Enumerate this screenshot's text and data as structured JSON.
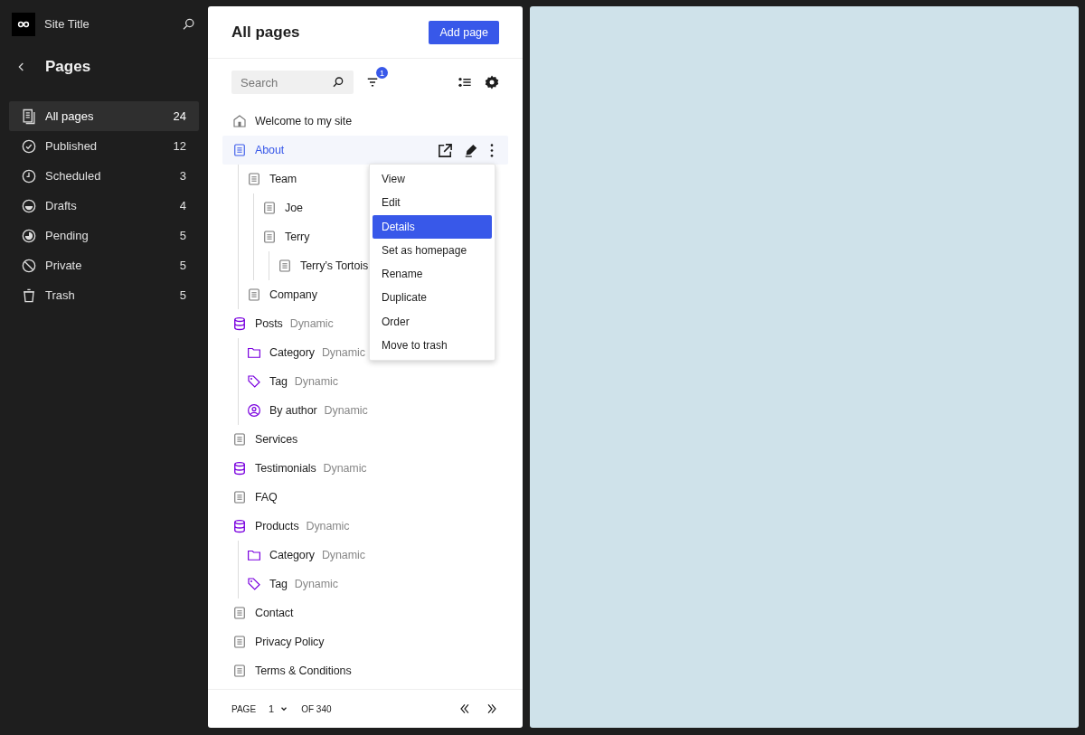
{
  "sidebar": {
    "site_title": "Site Title",
    "heading": "Pages",
    "items": [
      {
        "label": "All pages",
        "count": "24",
        "kind": "all",
        "selected": true
      },
      {
        "label": "Published",
        "count": "12",
        "kind": "published",
        "selected": false
      },
      {
        "label": "Scheduled",
        "count": "3",
        "kind": "scheduled",
        "selected": false
      },
      {
        "label": "Drafts",
        "count": "4",
        "kind": "drafts",
        "selected": false
      },
      {
        "label": "Pending",
        "count": "5",
        "kind": "pending",
        "selected": false
      },
      {
        "label": "Private",
        "count": "5",
        "kind": "private",
        "selected": false
      },
      {
        "label": "Trash",
        "count": "5",
        "kind": "trash",
        "selected": false
      }
    ]
  },
  "panel": {
    "title": "All pages",
    "add_button": "Add page",
    "search": {
      "placeholder": "Search"
    },
    "filter_badge": "1",
    "tree": [
      {
        "label": "Welcome to my site",
        "kind": "home",
        "selected": false
      },
      {
        "label": "About",
        "kind": "page",
        "selected": true,
        "children": [
          {
            "label": "Team",
            "kind": "page",
            "selected": false,
            "children": [
              {
                "label": "Joe",
                "kind": "page",
                "selected": false
              },
              {
                "label": "Terry",
                "kind": "page",
                "selected": false,
                "children": [
                  {
                    "label": "Terry’s Tortois",
                    "kind": "page",
                    "selected": false
                  }
                ]
              }
            ]
          },
          {
            "label": "Company",
            "kind": "page",
            "selected": false
          }
        ]
      },
      {
        "label": "Posts",
        "tag": "Dynamic",
        "kind": "dynamic",
        "selected": false,
        "children": [
          {
            "label": "Category",
            "tag": "Dynamic",
            "kind": "category",
            "selected": false
          },
          {
            "label": "Tag",
            "tag": "Dynamic",
            "kind": "tag",
            "selected": false
          },
          {
            "label": "By author",
            "tag": "Dynamic",
            "kind": "author",
            "selected": false
          }
        ]
      },
      {
        "label": "Services",
        "kind": "page",
        "selected": false
      },
      {
        "label": "Testimonials",
        "tag": "Dynamic",
        "kind": "dynamic",
        "selected": false
      },
      {
        "label": "FAQ",
        "kind": "page",
        "selected": false
      },
      {
        "label": "Products",
        "tag": "Dynamic",
        "kind": "dynamic",
        "selected": false,
        "children": [
          {
            "label": "Category",
            "tag": "Dynamic",
            "kind": "category",
            "selected": false
          },
          {
            "label": "Tag",
            "tag": "Dynamic",
            "kind": "tag",
            "selected": false
          }
        ]
      },
      {
        "label": "Contact",
        "kind": "page",
        "selected": false
      },
      {
        "label": "Privacy Policy",
        "kind": "page",
        "selected": false
      },
      {
        "label": "Terms & Conditions",
        "kind": "page",
        "selected": false
      }
    ],
    "context_menu": {
      "items": [
        {
          "label": "View",
          "selected": false
        },
        {
          "label": "Edit",
          "selected": false
        },
        {
          "label": "Details",
          "selected": true
        },
        {
          "label": "Set as homepage",
          "selected": false
        },
        {
          "label": "Rename",
          "selected": false
        },
        {
          "label": "Duplicate",
          "selected": false
        },
        {
          "label": "Order",
          "selected": false
        },
        {
          "label": "Move to trash",
          "selected": false
        }
      ]
    },
    "pagination": {
      "label": "PAGE",
      "current": "1",
      "total": "OF 340"
    }
  }
}
